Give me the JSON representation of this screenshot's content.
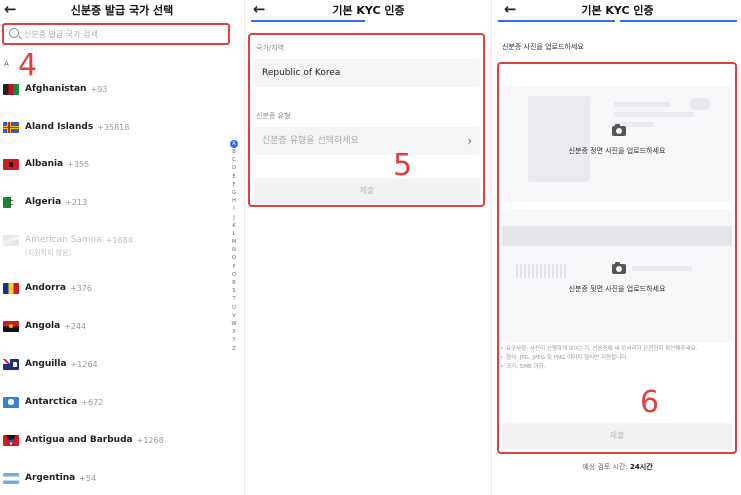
{
  "panel1": {
    "title": "신분증 발급 국가 선택",
    "search_placeholder": "신분증 발급 국가 검색",
    "marker": "4",
    "section_letter": "A",
    "countries": [
      {
        "name": "Afghanistan",
        "code": "+93"
      },
      {
        "name": "Aland Islands",
        "code": "+35818"
      },
      {
        "name": "Albania",
        "code": "+355"
      },
      {
        "name": "Algeria",
        "code": "+213"
      },
      {
        "name": "American Samoa",
        "code": "+1684",
        "note": "(지원하지 않음)"
      },
      {
        "name": "Andorra",
        "code": "+376"
      },
      {
        "name": "Angola",
        "code": "+244"
      },
      {
        "name": "Anguilla",
        "code": "+1264"
      },
      {
        "name": "Antarctica",
        "code": "+672"
      },
      {
        "name": "Antigua and Barbuda",
        "code": "+1268"
      },
      {
        "name": "Argentina",
        "code": "+54"
      }
    ],
    "alphabet": [
      "A",
      "B",
      "C",
      "D",
      "E",
      "F",
      "G",
      "H",
      "I",
      "J",
      "K",
      "L",
      "M",
      "N",
      "O",
      "P",
      "Q",
      "R",
      "S",
      "T",
      "U",
      "V",
      "W",
      "X",
      "Y",
      "Z"
    ]
  },
  "panel2": {
    "title": "기본 KYC 인증",
    "marker": "5",
    "country_label": "국가/지역",
    "country_value": "Republic of Korea",
    "idtype_label": "신분증 유형",
    "idtype_placeholder": "신분증 유형을 선택하세요",
    "submit": "제출"
  },
  "panel3": {
    "title": "기본 KYC 인증",
    "marker": "6",
    "instruction": "신분증 사진을 업로드하세요",
    "front_caption": "신분증 정면 사진을 업로드하세요",
    "back_caption": "신분증 뒷면 사진을 업로드하세요",
    "notes": [
      "요구사항: 사진이 선명하게 보이는지, 신분증에 네 모서리가 온전한지 확인해주세요.",
      "형식: JPG, JPEG 및 PNG 이미지 형식만 지원합니다.",
      "크기: 5MB 이하."
    ],
    "submit": "제출",
    "review_label": "예상 검토 시간:",
    "review_time": "24시간"
  },
  "colors": {
    "accent": "#2b6ff0",
    "highlight": "#e04040"
  },
  "icons": {
    "back": "arrow-left-icon",
    "search": "search-icon",
    "camera": "camera-icon",
    "chevron": "chevron-right-icon"
  }
}
